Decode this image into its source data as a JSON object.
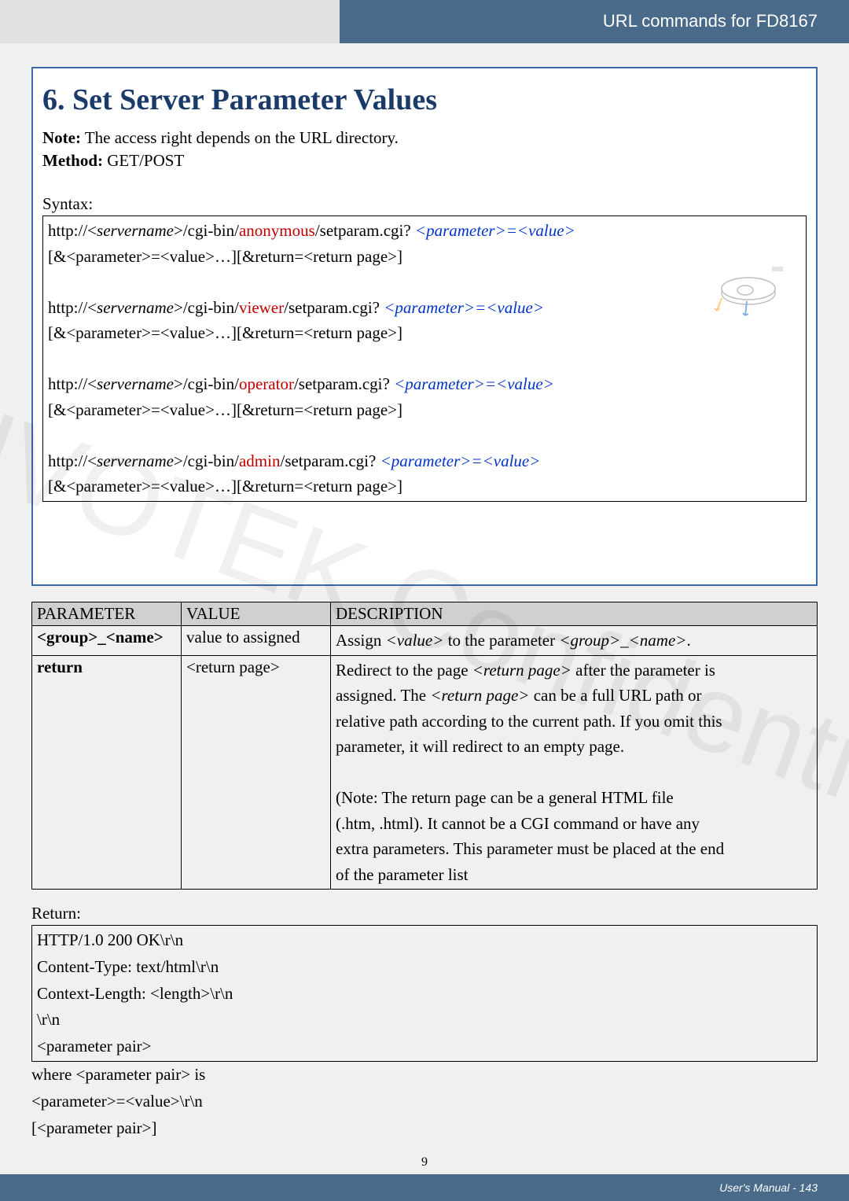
{
  "header": {
    "title": "URL commands for FD8167"
  },
  "main": {
    "section_number_title": "6. Set Server Parameter Values",
    "note_label": "Note:",
    "note_text": " The access right depends on the URL directory.",
    "method_label": "Method:",
    "method_value": " GET/POST",
    "syntax_label": "Syntax:",
    "syntax_lines": {
      "l1a": "http://<",
      "l1b": "servername",
      "l1c": ">/cgi-bin/",
      "l1d": "anonymous",
      "l1e": "/setparam.cgi? ",
      "l1f": "<parameter>=<value>",
      "l2": "[&<parameter>=<value>…][&return=<return page>]",
      "l3a": "http://<",
      "l3b": "servername",
      "l3c": ">/cgi-bin/",
      "l3d": "viewer",
      "l3e": "/setparam.cgi? ",
      "l3f": "<parameter>=<value>",
      "l4": "[&<parameter>=<value>…][&return=<return page>]",
      "l5a": "http://<",
      "l5b": "servername",
      "l5c": ">/cgi-bin/",
      "l5d": "operator",
      "l5e": "/setparam.cgi? ",
      "l5f": "<parameter>=<value>",
      "l6": "[&<parameter>=<value>…][&return=<return page>]",
      "l7a": "http://<",
      "l7b": "servername",
      "l7c": ">/cgi-bin/",
      "l7d": "admin",
      "l7e": "/setparam.cgi? ",
      "l7f": "<parameter>=<value>",
      "l8": "[&<parameter>=<value>…][&return=<return page>]"
    }
  },
  "table": {
    "headers": [
      "PARAMETER",
      "VALUE",
      "DESCRIPTION"
    ],
    "rows": [
      {
        "param": "<group>_<name>",
        "value": "value to assigned",
        "desc_pre": "Assign ",
        "desc_v": "<value>",
        "desc_mid": " to the parameter ",
        "desc_g": "<group>",
        "desc_us": "_",
        "desc_n": "<name>",
        "desc_post": "."
      },
      {
        "param": "return",
        "value": "<return page>",
        "d1a": "Redirect to the page ",
        "d1b": "<return page>",
        "d1c": " after the parameter is",
        "d2a": "assigned. The ",
        "d2b": "<return page>",
        "d2c": " can be a full URL path or",
        "d3": "relative path according to the current path. If you omit this",
        "d4": "parameter, it will redirect to an empty page.",
        "d5": "(Note: The return page can be a general HTML file",
        "d6": "(.htm, .html). It cannot be a CGI command or have any",
        "d7": "extra parameters. This parameter must be placed at the end",
        "d8": "of the parameter list"
      }
    ]
  },
  "return": {
    "label": "Return:",
    "lines": [
      "HTTP/1.0 200 OK\\r\\n",
      "Content-Type: text/html\\r\\n",
      "Context-Length: <length>\\r\\n",
      "\\r\\n",
      "<parameter pair>"
    ],
    "after": [
      "where <parameter pair> is",
      "<parameter>=<value>\\r\\n",
      "[<parameter pair>]"
    ]
  },
  "footer": {
    "page_number": "9",
    "manual": "User's Manual - 143"
  },
  "watermark_text": "VIVOTEK Confidential"
}
